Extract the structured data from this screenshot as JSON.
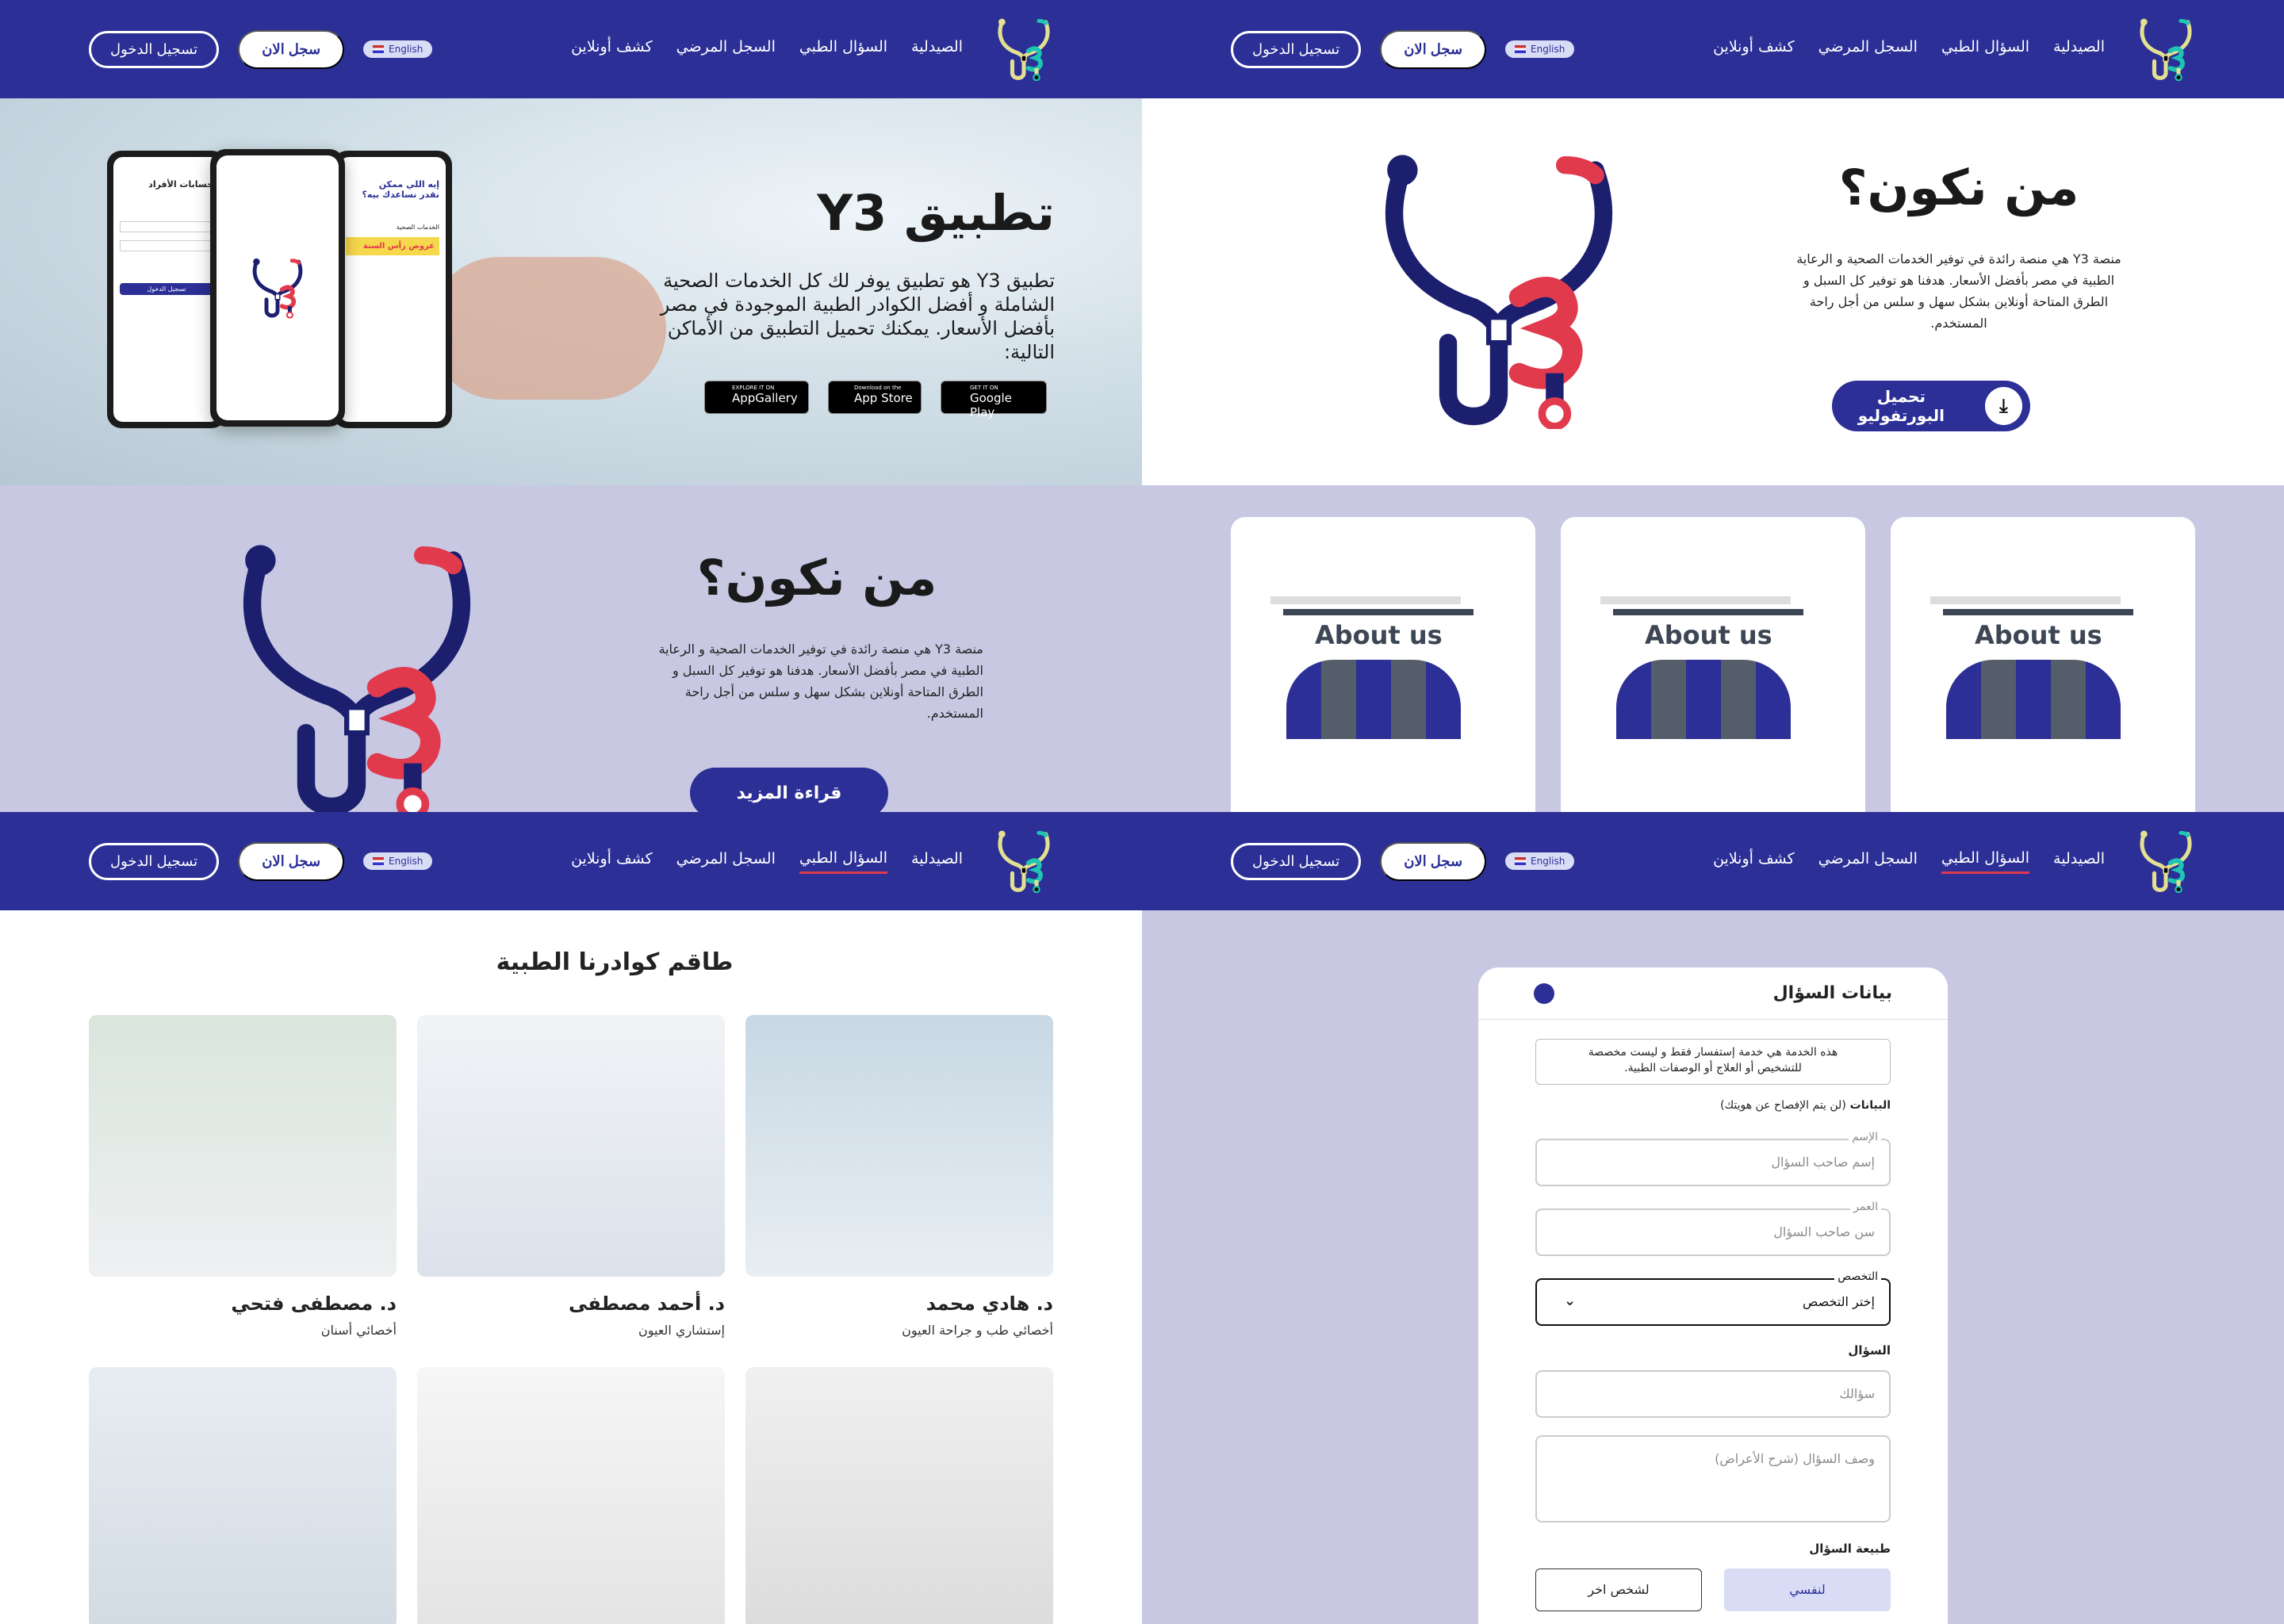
{
  "nav": {
    "links": [
      "الصيدلية",
      "السؤال الطبي",
      "السجل المرضي",
      "كشف أونلاين"
    ],
    "lang": "English",
    "register": "سجل الان",
    "login": "تسجيل الدخول"
  },
  "app_panel": {
    "title": "تطبيق Y3",
    "body": "تطبيق Y3 هو تطبيق يوفر لك كل الخدمات الصحية الشاملة و أفضل الكوادر الطبية الموجودة في مصر بأفضل الأسعار. يمكنك تحميل التطبيق من الأماكن التالية:",
    "stores": [
      {
        "small": "EXPLORE IT ON",
        "big": "AppGallery"
      },
      {
        "small": "Download on the",
        "big": "App Store"
      },
      {
        "small": "GET IT ON",
        "big": "Google Play"
      }
    ],
    "phone_left": {
      "title": "حسابات الأفراد",
      "login": "تسجيل الدخول"
    },
    "phone_right": {
      "line1": "إيه اللي ممكن",
      "line2": "نقدر نساعدك بيه؟",
      "section": "الخدمات الصحية",
      "promo": "عروض رأس السنة"
    }
  },
  "about_white": {
    "title": "من نكون؟",
    "body": "منصة Y3 هي منصة رائدة في توفير الخدمات الصحية و الرعاية الطبية في مصر بأفضل الأسعار. هدفنا هو توفير كل السبل و الطرق المتاحة أونلاين بشكل سهل و سلس من أجل راحة المستخدم.",
    "button": "تحميل البورتفوليو"
  },
  "about_lav": {
    "title": "من نكون؟",
    "body": "منصة Y3 هي منصة رائدة في توفير الخدمات الصحية و الرعاية الطبية في مصر بأفضل الأسعار. هدفنا هو توفير كل السبل و الطرق المتاحة أونلاين بشكل سهل و سلس من أجل راحة المستخدم.",
    "button": "قراءة المزيد"
  },
  "about_cards": [
    "About us",
    "About us",
    "About us"
  ],
  "team": {
    "title": "طاقم كوادرنا الطبية",
    "doctors": [
      {
        "name": "د. هادي محمد",
        "role": "أخصائي طب و جراحة العيون"
      },
      {
        "name": "د. أحمد مصطفى",
        "role": "إستشاري العيون"
      },
      {
        "name": "د. مصطفى فتحي",
        "role": "أخصائي أسنان"
      },
      {
        "name": "",
        "role": ""
      },
      {
        "name": "",
        "role": ""
      },
      {
        "name": "",
        "role": ""
      }
    ]
  },
  "form": {
    "title": "بيانات السؤال",
    "notice": "هذه الخدمة هي خدمة إستفسار فقط و ليست مخصصة للتشخيص أو العلاج أو الوصفات الطبية.",
    "data_label": "البيانات",
    "data_note": "(لن يتم الإفصاح عن هويتك)",
    "name_label": "الإسم",
    "name_ph": "إسم صاحب السؤال",
    "age_label": "العمر",
    "age_ph": "سن صاحب السؤال",
    "spec_label": "التخصص",
    "spec_value": "إختر التخصص",
    "question_label": "السؤال",
    "question_ph": "سؤالك",
    "desc_ph": "وصف السؤال (شرح الأعراض)",
    "type_label": "طبيعة السؤال",
    "opt_self": "لنفسي",
    "opt_other": "لشخص اخر"
  },
  "colors": {
    "primary": "#2b2f96",
    "accent": "#e23a4d",
    "lavender": "#c9c8e3"
  }
}
